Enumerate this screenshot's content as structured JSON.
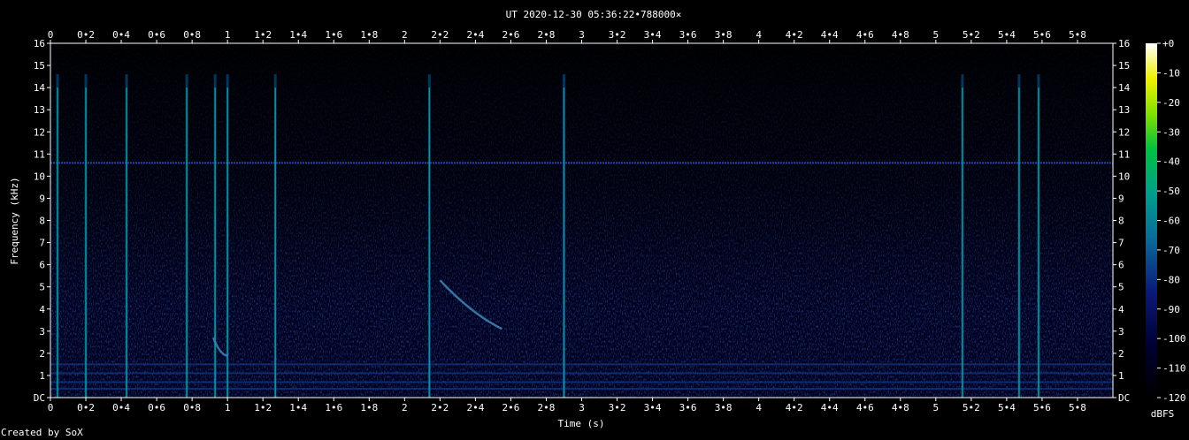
{
  "chart_data": {
    "type": "heatmap",
    "title": "UT 2020-12-30 05:36:22•788000×",
    "xlabel": "Time (s)",
    "ylabel": "Frequency (kHz)",
    "xlim": [
      0,
      5.98
    ],
    "ylim": [
      0,
      16
    ],
    "x_ticks": [
      "0",
      "0•2",
      "0•4",
      "0•6",
      "0•8",
      "1",
      "1•2",
      "1•4",
      "1•6",
      "1•8",
      "2",
      "2•2",
      "2•4",
      "2•6",
      "2•8",
      "3",
      "3•2",
      "3•4",
      "3•6",
      "3•8",
      "4",
      "4•2",
      "4•4",
      "4•6",
      "4•8",
      "5",
      "5•2",
      "5•4",
      "5•6",
      "5•8"
    ],
    "y_ticks": [
      "DC",
      "1",
      "2",
      "3",
      "4",
      "5",
      "6",
      "7",
      "8",
      "9",
      "10",
      "11",
      "12",
      "13",
      "14",
      "15",
      "16"
    ],
    "colorbar": {
      "label": "dBFS",
      "ticks": [
        "+0",
        "-10",
        "-20",
        "-30",
        "-40",
        "-50",
        "-60",
        "-70",
        "-80",
        "-90",
        "-100",
        "-110",
        "-120"
      ],
      "range": [
        -120,
        0
      ]
    },
    "features": {
      "constant_tone_khz": 10.6,
      "broadband_transients_s": [
        0.04,
        0.2,
        0.43,
        0.77,
        0.93,
        1.0,
        1.27,
        2.14,
        2.9,
        5.15,
        5.47,
        5.58
      ],
      "descending_chirps": [
        {
          "t_start": 0.92,
          "t_end": 1.0,
          "f_start_khz": 2.7,
          "f_end_khz": 1.9
        },
        {
          "t_start": 2.2,
          "t_end": 2.55,
          "f_start_khz": 5.3,
          "f_end_khz": 3.1
        }
      ]
    },
    "grid": false
  },
  "footer": {
    "credit": "Created by SoX"
  },
  "colors": {
    "background": "#000000",
    "plot_bg": "#000022",
    "text": "#ffffff"
  }
}
